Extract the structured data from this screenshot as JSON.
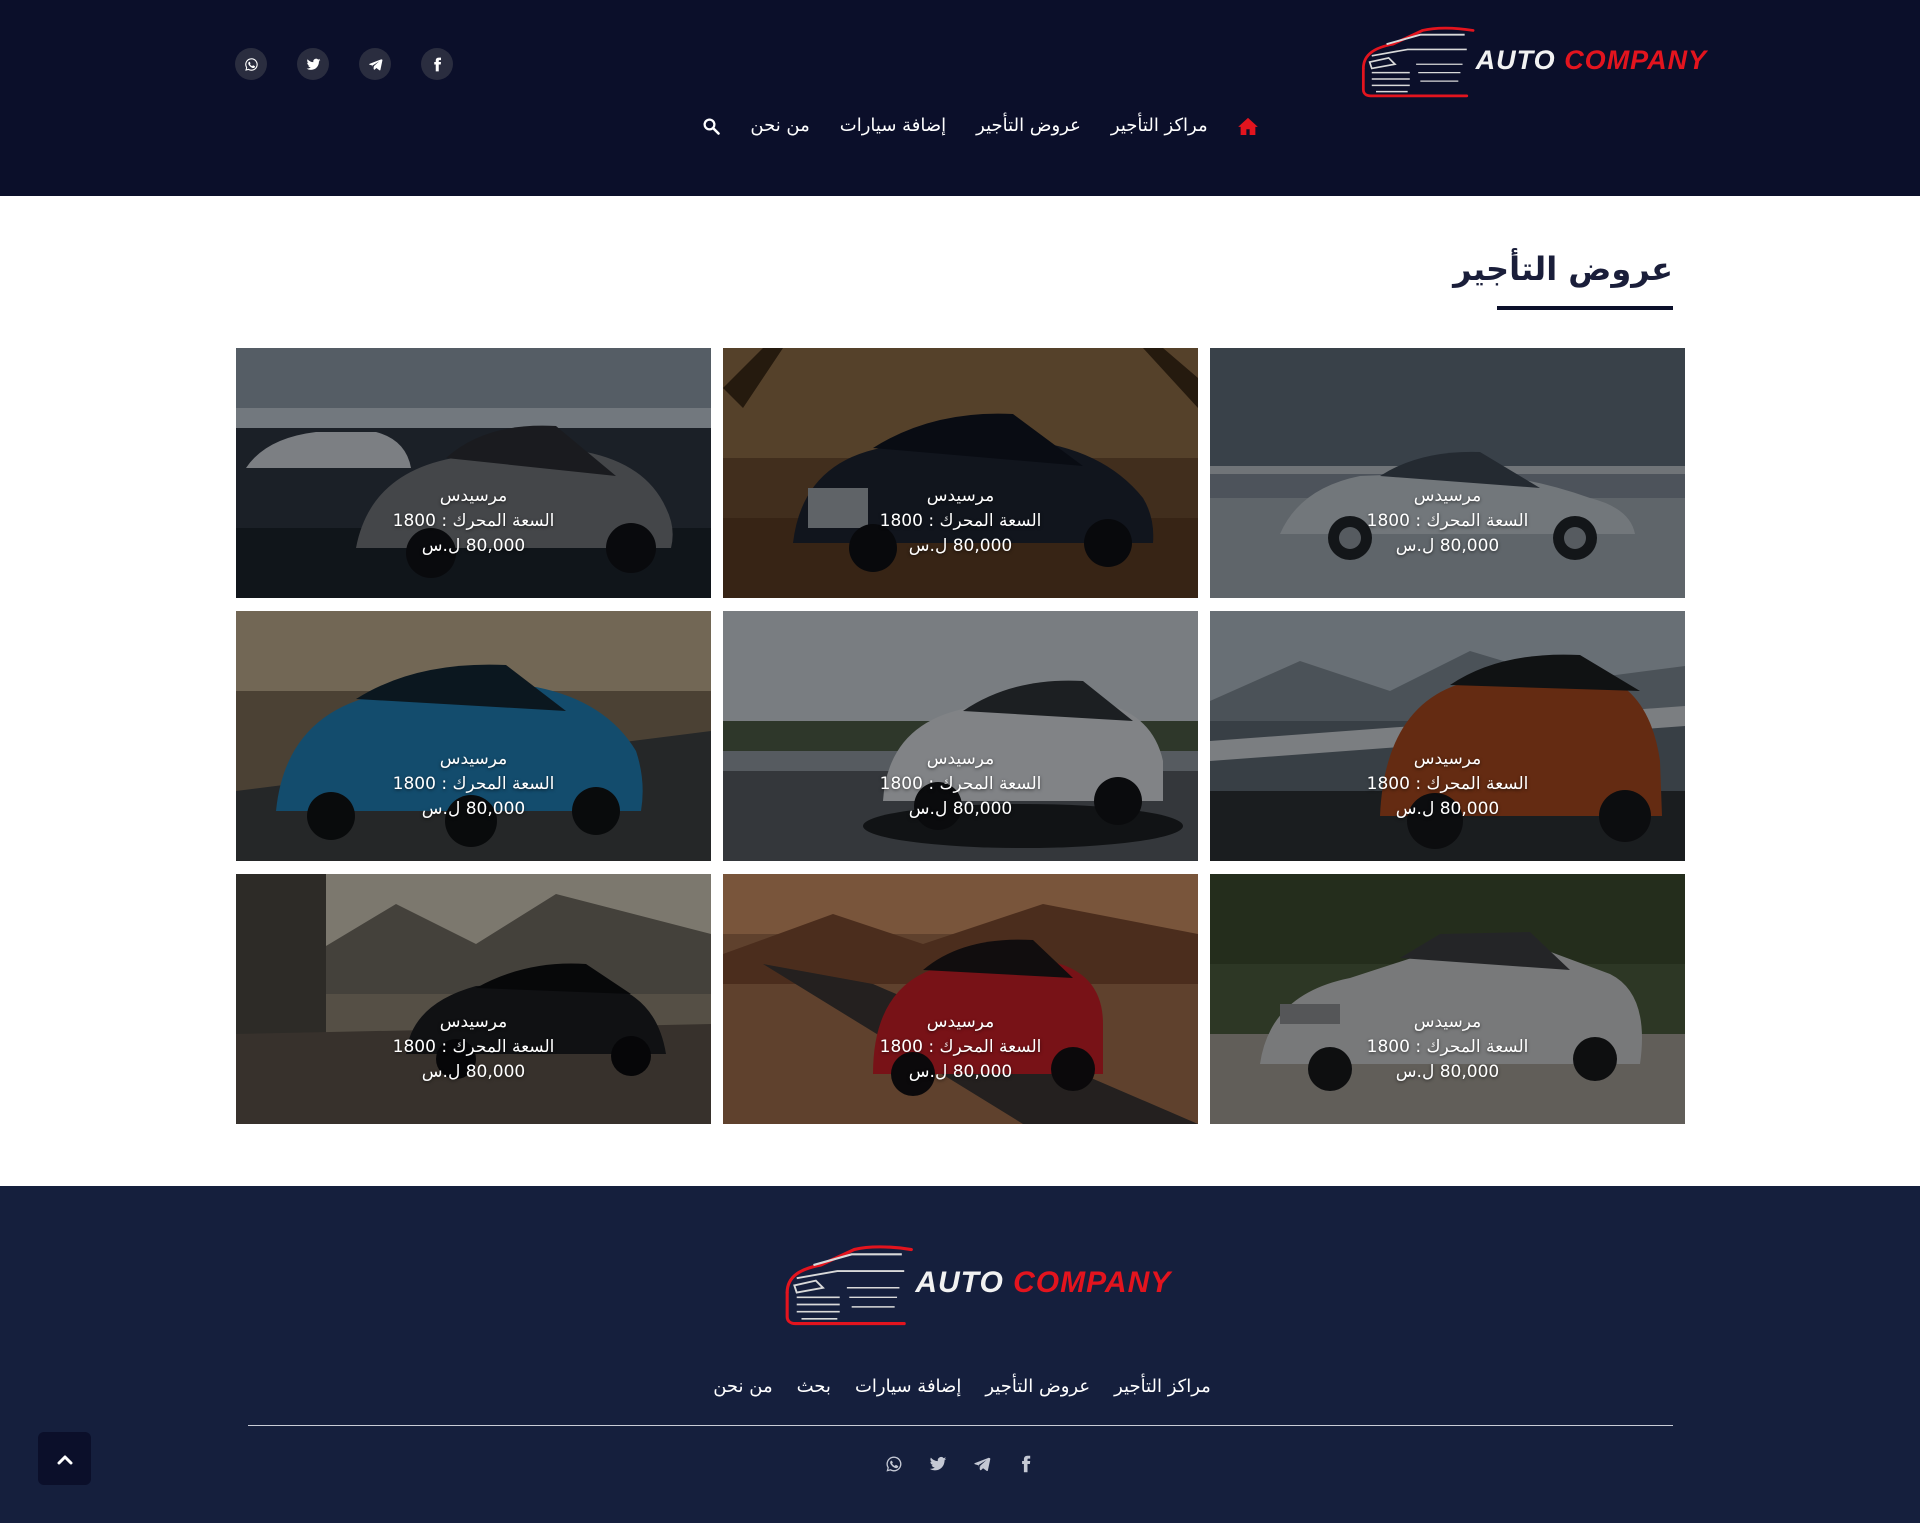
{
  "brand": {
    "word1": "AUTO",
    "word2": "COMPANY"
  },
  "colors": {
    "header_bg": "#0b0f2a",
    "footer_bg": "#151f3d",
    "accent": "#e3141e",
    "social_circle": "#2a2d3f"
  },
  "header": {
    "social": [
      {
        "icon": "whatsapp-icon"
      },
      {
        "icon": "twitter-icon"
      },
      {
        "icon": "telegram-icon"
      },
      {
        "icon": "facebook-icon"
      }
    ],
    "nav": {
      "home_icon": "home-icon",
      "items": [
        "مراكز التأجير",
        "عروض التأجير",
        "إضافة سيارات",
        "من نحن"
      ],
      "search_icon": "search-icon"
    }
  },
  "main": {
    "title": "عروض التأجير",
    "cards": [
      {
        "name": "مرسيدس",
        "engine": "السعة المحرك : 1800",
        "price": "80,000 ل.س"
      },
      {
        "name": "مرسيدس",
        "engine": "السعة المحرك : 1800",
        "price": "80,000 ل.س"
      },
      {
        "name": "مرسيدس",
        "engine": "السعة المحرك : 1800",
        "price": "80,000 ل.س"
      },
      {
        "name": "مرسيدس",
        "engine": "السعة المحرك : 1800",
        "price": "80,000 ل.س"
      },
      {
        "name": "مرسيدس",
        "engine": "السعة المحرك : 1800",
        "price": "80,000 ل.س"
      },
      {
        "name": "مرسيدس",
        "engine": "السعة المحرك : 1800",
        "price": "80,000 ل.س"
      },
      {
        "name": "مرسيدس",
        "engine": "السعة المحرك : 1800",
        "price": "80,000 ل.س"
      },
      {
        "name": "مرسيدس",
        "engine": "السعة المحرك : 1800",
        "price": "80,000 ل.س"
      },
      {
        "name": "مرسيدس",
        "engine": "السعة المحرك : 1800",
        "price": "80,000 ل.س"
      }
    ]
  },
  "footer": {
    "links": [
      "مراكز التأجير",
      "عروض التأجير",
      "إضافة سيارات",
      "بحث",
      "من نحن"
    ],
    "social": [
      {
        "icon": "whatsapp-icon"
      },
      {
        "icon": "twitter-icon"
      },
      {
        "icon": "telegram-icon"
      },
      {
        "icon": "facebook-icon"
      }
    ]
  },
  "back_to_top_icon": "chevron-up-icon"
}
